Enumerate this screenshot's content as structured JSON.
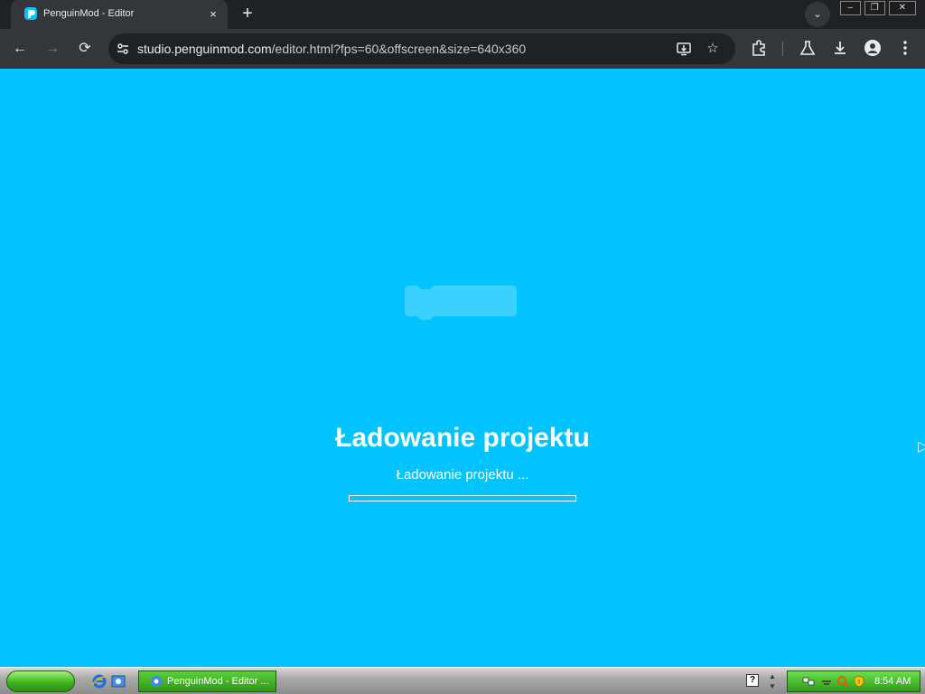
{
  "browser": {
    "tab": {
      "title": "PenguinMod - Editor",
      "close_glyph": "×",
      "favicon": "penguinmod-logo-icon"
    },
    "new_tab_glyph": "+",
    "tab_search_glyph": "⌄",
    "window_controls": {
      "minimize": "–",
      "restore": "❐",
      "close": "✕"
    },
    "nav": {
      "back": "←",
      "forward": "→",
      "reload": "⟳"
    },
    "url": {
      "host": "studio.penguinmod.com",
      "path": "/editor.html?fps=60&offscreen&size=640x360"
    },
    "icons": [
      "install-app-icon",
      "bookmark-star-icon",
      "extensions-icon",
      "labs-icon",
      "download-icon",
      "profile-icon",
      "menu-icon"
    ]
  },
  "page": {
    "background_color": "#00c3ff",
    "title": "Ładowanie projektu",
    "subtitle": "Ładowanie projektu ...",
    "progress_fraction": 0
  },
  "taskbar": {
    "task_label": "PenguinMod - Editor ...",
    "help_glyph": "?",
    "clock": "8:54 AM"
  }
}
